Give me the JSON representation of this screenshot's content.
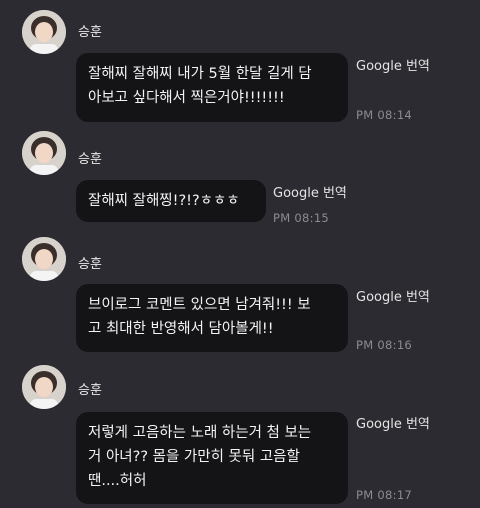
{
  "messages": [
    {
      "sender": "승훈",
      "text": "잘해찌 잘해찌 내가 5월 한달 길게 담\n아보고 싶다해서 찍은거야!!!!!!!",
      "translate_label": "Google 번역",
      "time": "PM 08:14"
    },
    {
      "sender": "승훈",
      "text": "잘해찌 잘해찡!?!?ㅎㅎㅎ",
      "translate_label": "Google 번역",
      "time": "PM 08:15"
    },
    {
      "sender": "승훈",
      "text": "브이로그 코멘트 있으면 남겨줘!!! 보\n고 최대한 반영해서 담아볼게!!",
      "translate_label": "Google 번역",
      "time": "PM 08:16"
    },
    {
      "sender": "승훈",
      "text": "저렇게 고음하는 노래 하는거 첨 보는\n거 아녀?? 몸을 가만히 못둬 고음할\n땐....허허",
      "translate_label": "Google 번역",
      "time": "PM 08:17"
    }
  ],
  "colors": {
    "background": "#2c2b31",
    "bubble": "#141417",
    "time": "#8b8b92"
  }
}
